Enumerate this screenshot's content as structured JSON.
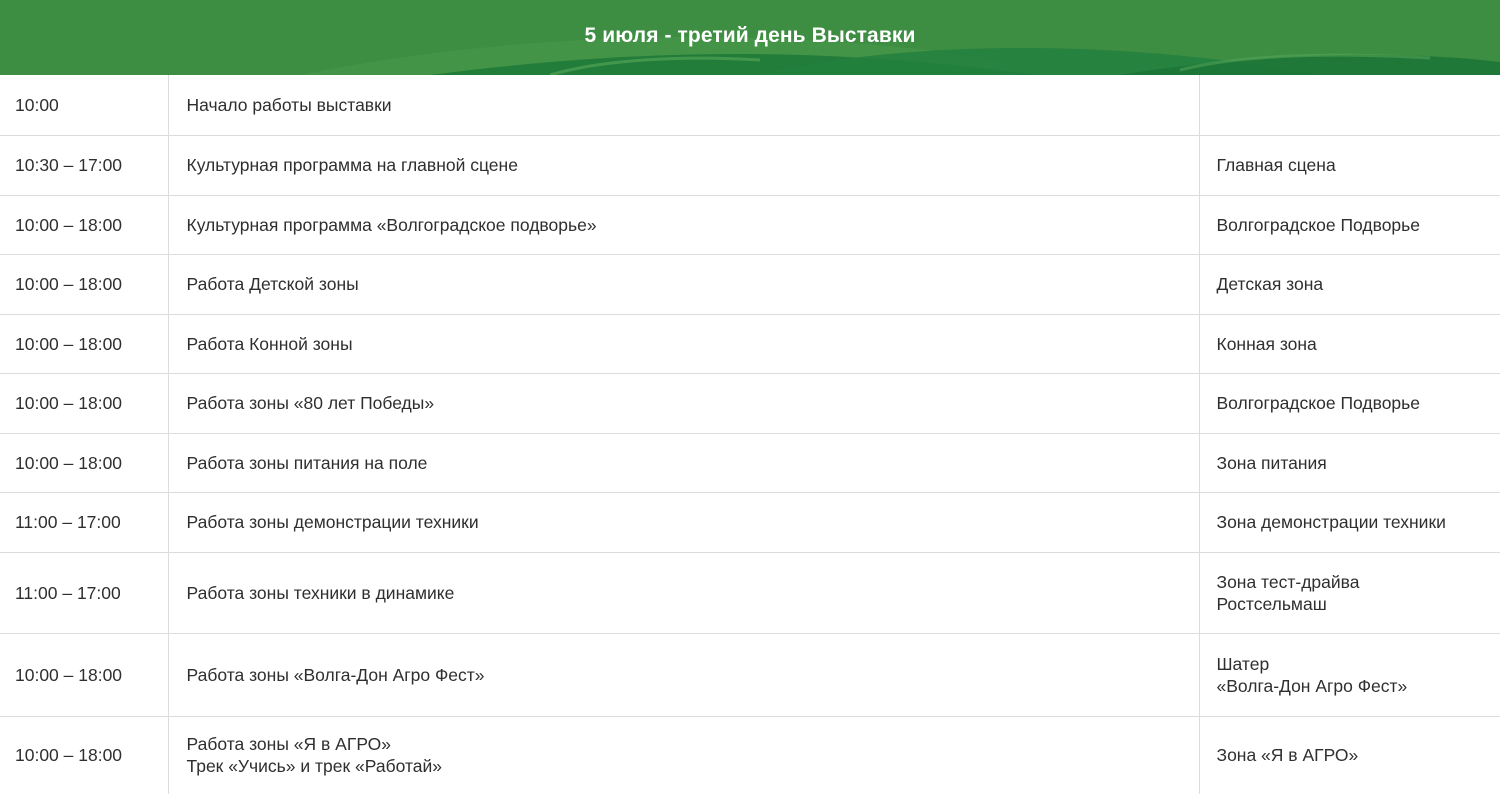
{
  "header": {
    "title": "5 июля - третий день Выставки",
    "color": "#3a8a3f"
  },
  "schedule": {
    "rows": [
      {
        "time": "10:00",
        "event": "Начало работы выставки",
        "place": ""
      },
      {
        "time": "10:30 – 17:00",
        "event": "Культурная программа на главной сцене",
        "place": "Главная сцена"
      },
      {
        "time": "10:00 – 18:00",
        "event": "Культурная программа «Волгоградское подворье»",
        "place": "Волгоградское Подворье"
      },
      {
        "time": "10:00 – 18:00",
        "event": "Работа Детской зоны",
        "place": "Детская зона"
      },
      {
        "time": "10:00 – 18:00",
        "event": "Работа Конной зоны",
        "place": "Конная зона"
      },
      {
        "time": "10:00 – 18:00",
        "event": "Работа зоны «80 лет Победы»",
        "place": "Волгоградское Подворье"
      },
      {
        "time": "10:00 – 18:00",
        "event": "Работа зоны питания на поле",
        "place": "Зона питания"
      },
      {
        "time": "11:00 – 17:00",
        "event": "Работа зоны демонстрации техники",
        "place": "Зона демонстрации техники"
      },
      {
        "time": "11:00 – 17:00",
        "event": "Работа зоны техники в динамике",
        "place": "Зона тест-драйва\nРостсельмаш"
      },
      {
        "time": "10:00 – 18:00",
        "event": "Работа зоны «Волга-Дон Агро Фест»",
        "place": "Шатер\n«Волга-Дон Агро Фест»"
      },
      {
        "time": "10:00 – 18:00",
        "event": "Работа зоны «Я в АГРО»\nТрек «Учись» и трек «Работай»",
        "place": "Зона «Я в АГРО»"
      }
    ]
  }
}
